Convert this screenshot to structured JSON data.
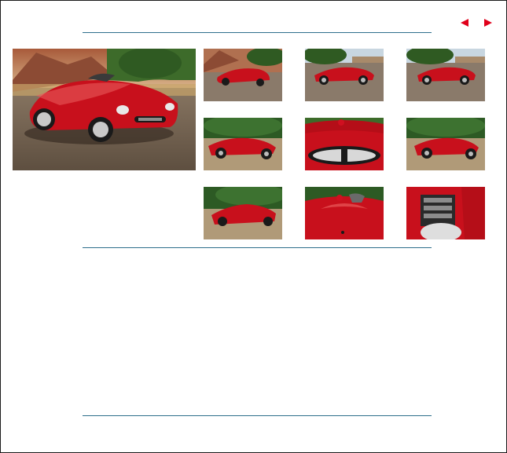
{
  "navigation": {
    "prev_icon": "triangle-left-icon",
    "next_icon": "triangle-right-icon",
    "arrow_color": "#e0001a"
  },
  "gallery": {
    "main_photo": "red-roadster-front-three-quarter",
    "thumbnails": [
      "red-roadster-quarry-side",
      "red-roadster-side-profile",
      "red-roadster-side-profile-alt",
      "red-roadster-front-forest",
      "red-roadster-grille-closeup",
      "red-roadster-front-forest-alt",
      "red-roadster-low-front-forest",
      "red-roadster-hood-closeup",
      "red-roadster-engine-bay"
    ]
  },
  "colors": {
    "rule": "#2e6f8c",
    "car_red": "#c8101c",
    "frame": "#1a1a1a"
  }
}
